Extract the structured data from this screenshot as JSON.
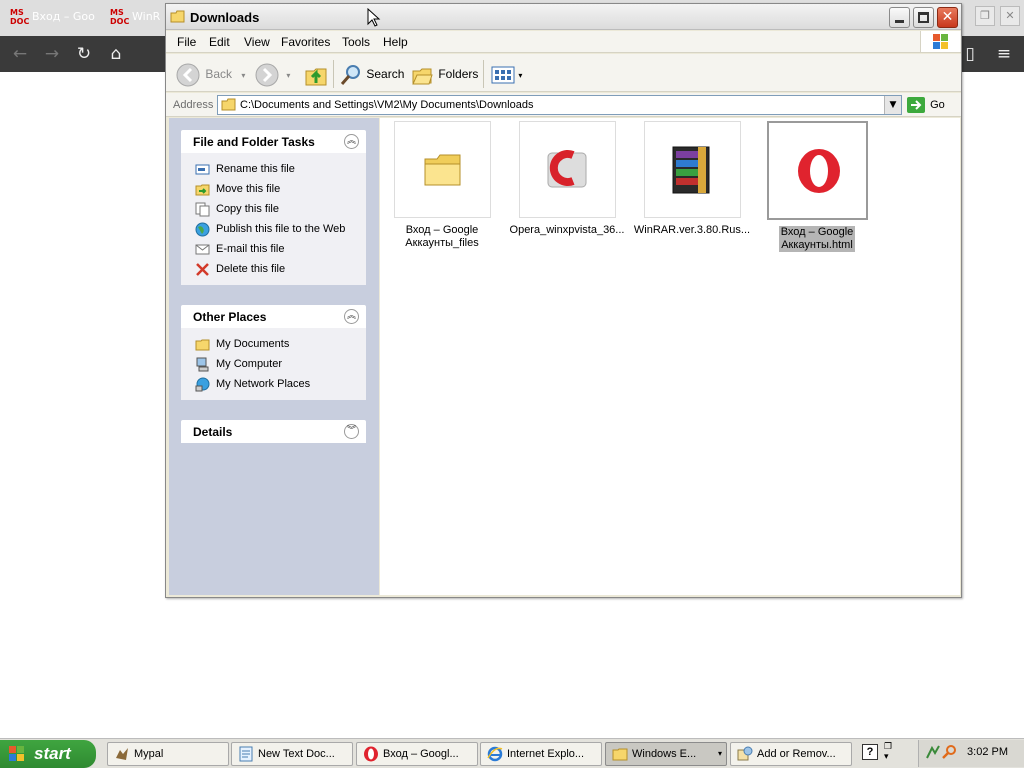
{
  "background_browser": {
    "tabs": [
      {
        "label": "Вход – Goo",
        "icon": "ms-doc-icon"
      },
      {
        "label": "WinR",
        "icon": "ms-doc-icon"
      }
    ]
  },
  "window": {
    "title": "Downloads",
    "menu": [
      "File",
      "Edit",
      "View",
      "Favorites",
      "Tools",
      "Help"
    ],
    "toolbar": {
      "back": "Back",
      "search": "Search",
      "folders": "Folders"
    },
    "address": {
      "label": "Address",
      "path": "C:\\Documents and Settings\\VM2\\My Documents\\Downloads",
      "go": "Go"
    },
    "panels": {
      "file_tasks": {
        "title": "File and Folder Tasks",
        "items": [
          {
            "label": "Rename this file",
            "icon": "rename-icon"
          },
          {
            "label": "Move this file",
            "icon": "move-icon"
          },
          {
            "label": "Copy this file",
            "icon": "copy-icon"
          },
          {
            "label": "Publish this file to the Web",
            "icon": "globe-icon"
          },
          {
            "label": "E-mail this file",
            "icon": "email-icon"
          },
          {
            "label": "Delete this file",
            "icon": "delete-icon"
          }
        ]
      },
      "other_places": {
        "title": "Other Places",
        "items": [
          {
            "label": "My Documents",
            "icon": "folder-icon"
          },
          {
            "label": "My Computer",
            "icon": "computer-icon"
          },
          {
            "label": "My Network Places",
            "icon": "network-icon"
          }
        ]
      },
      "details": {
        "title": "Details"
      }
    },
    "files": [
      {
        "name": "Вход – Google Аккаунты_files",
        "line1": "Вход – Google",
        "line2": "Аккаунты_files",
        "icon": "folder-icon"
      },
      {
        "name": "Opera_winxpvista_36...",
        "line1": "Opera_winxpvista_36...",
        "line2": "",
        "icon": "opera-installer-icon"
      },
      {
        "name": "WinRAR.ver.3.80.Rus...",
        "line1": "WinRAR.ver.3.80.Rus...",
        "line2": "",
        "icon": "winrar-icon"
      },
      {
        "name": "Вход – Google Аккаунты.html",
        "line1": "Вход – Google",
        "line2": "Аккаунты.html",
        "icon": "opera-icon",
        "selected": true
      }
    ]
  },
  "taskbar": {
    "start": "start",
    "tasks": [
      {
        "label": "Mypal",
        "icon": "mypal-icon"
      },
      {
        "label": "New Text Doc...",
        "icon": "notepad-icon"
      },
      {
        "label": "Вход – Googl...",
        "icon": "opera-icon"
      },
      {
        "label": "Internet Explo...",
        "icon": "ie-icon"
      },
      {
        "label": "Windows E...",
        "icon": "folder-icon",
        "active": true
      },
      {
        "label": "Add or Remov...",
        "icon": "add-remove-icon"
      }
    ],
    "clock": "3:02 PM"
  }
}
